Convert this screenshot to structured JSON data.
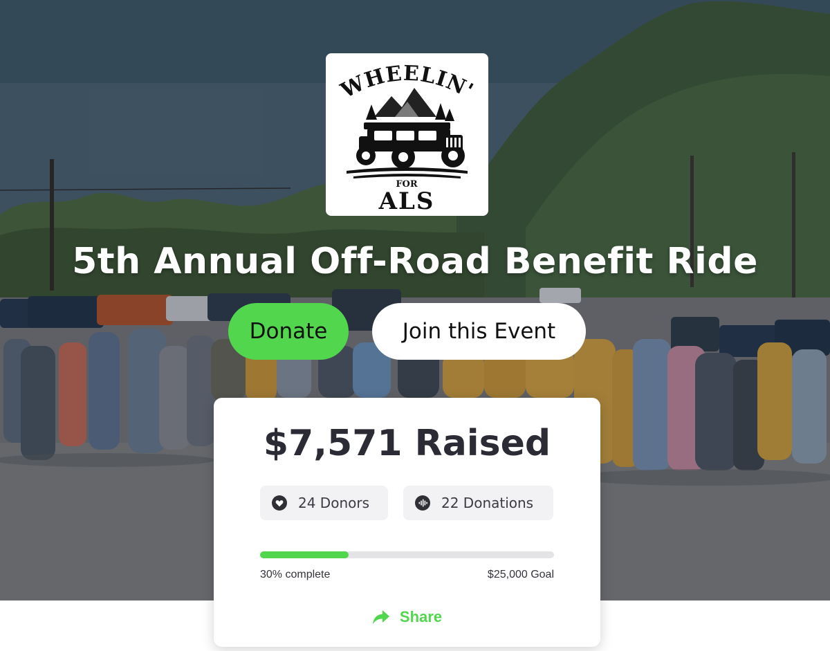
{
  "event": {
    "title": "5th Annual Off-Road Benefit Ride",
    "logo": {
      "top_text": "WHEELIN'",
      "middle_text": "FOR",
      "bottom_text": "ALS",
      "icon": "jeep-logo"
    }
  },
  "actions": {
    "donate_label": "Donate",
    "join_label": "Join this Event",
    "share_label": "Share"
  },
  "stats": {
    "raised_text": "$7,571 Raised",
    "donors_text": "24 Donors",
    "donations_text": "22 Donations",
    "progress_fraction": 0.3,
    "progress_text": "30% complete",
    "goal_text": "$25,000 Goal"
  },
  "icons": {
    "donors": "heart-icon",
    "donations": "audio-wave-icon",
    "share": "share-arrow-icon"
  },
  "colors": {
    "accent_green": "#52d64e",
    "text_dark": "#2b2b35",
    "pill_bg": "#f2f2f4",
    "track_bg": "#e4e4e7"
  }
}
